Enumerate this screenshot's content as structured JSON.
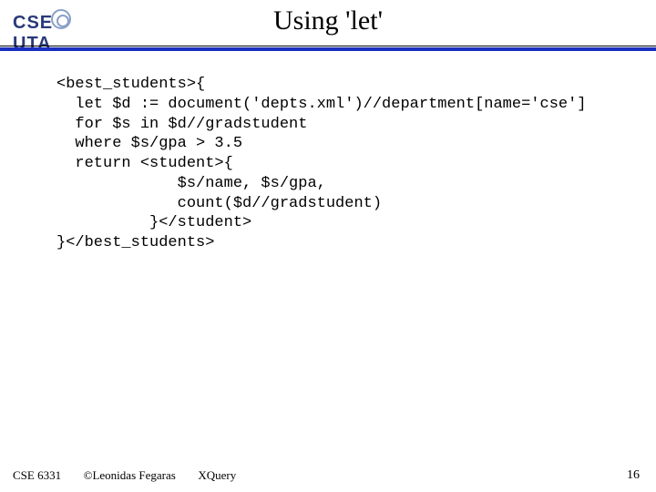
{
  "logo": {
    "left": "CSE",
    "right": "UTA"
  },
  "title": "Using 'let'",
  "code": {
    "l1": "<best_students>{",
    "l2": "  let $d := document('depts.xml')//department[name='cse']",
    "l3": "  for $s in $d//gradstudent",
    "l4": "  where $s/gpa > 3.5",
    "l5": "  return <student>{",
    "l6": "             $s/name, $s/gpa,",
    "l7": "             count($d//gradstudent)",
    "l8": "          }</student>",
    "l9": "}</best_students>"
  },
  "footer": {
    "course": "CSE 6331",
    "copyright": "©Leonidas Fegaras",
    "topic": "XQuery",
    "page": "16"
  }
}
